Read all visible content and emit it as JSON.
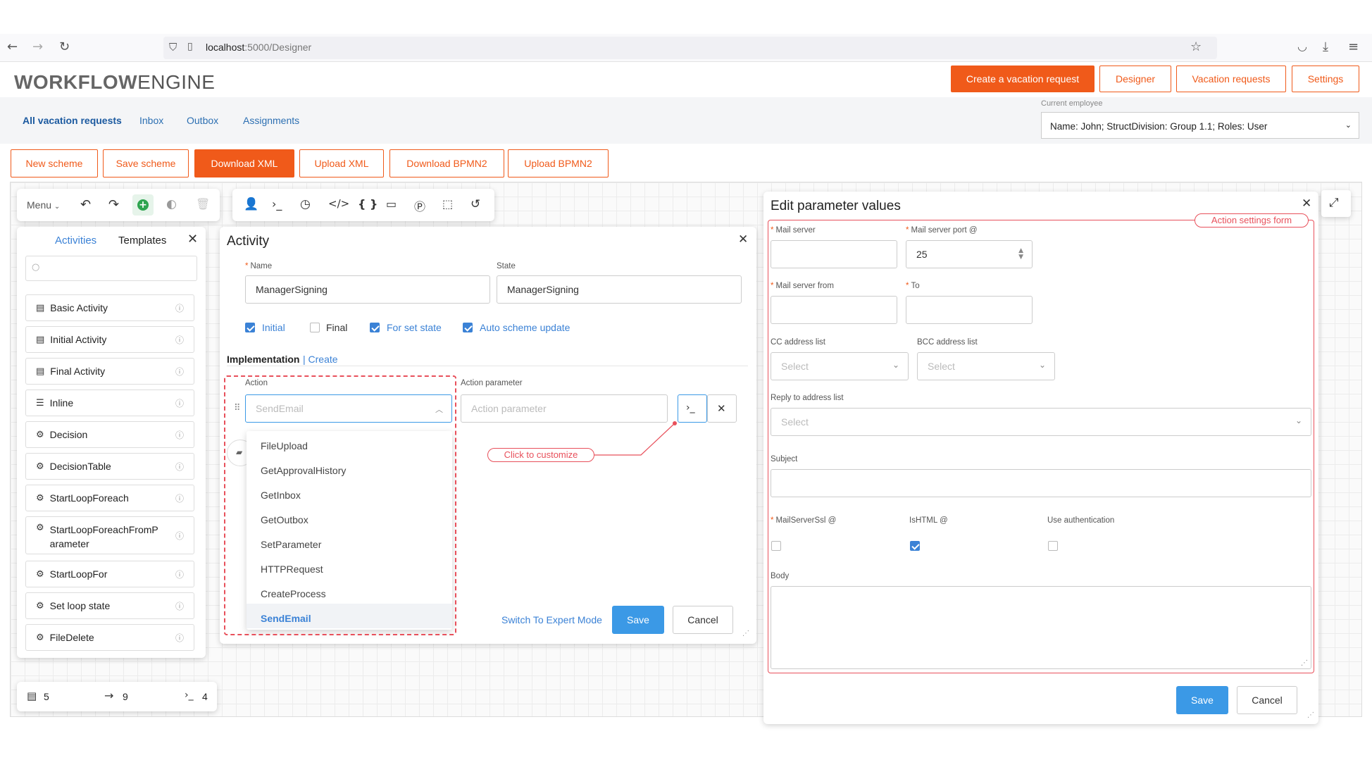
{
  "browser": {
    "url_host": "localhost",
    "url_path": ":5000/Designer"
  },
  "brand": {
    "bold": "WORKFLOW",
    "light": "ENGINE"
  },
  "header_buttons": [
    "Create a vacation request",
    "Designer",
    "Vacation requests",
    "Settings"
  ],
  "nav_tabs": [
    "All vacation requests",
    "Inbox",
    "Outbox",
    "Assignments"
  ],
  "employee": {
    "label": "Current employee",
    "value": "Name: John; StructDivision: Group 1.1; Roles: User"
  },
  "toolbar_buttons": [
    "New scheme",
    "Save scheme",
    "Download XML",
    "Upload XML",
    "Download BPMN2",
    "Upload BPMN2"
  ],
  "designer_menu": {
    "label": "Menu"
  },
  "side_panel": {
    "tab_activities": "Activities",
    "tab_templates": "Templates",
    "items": [
      "Basic Activity",
      "Initial Activity",
      "Final Activity",
      "Inline",
      "Decision",
      "DecisionTable",
      "StartLoopForeach",
      "StartLoopForeachFromParameter",
      "StartLoopFor",
      "Set loop state",
      "FileDelete"
    ]
  },
  "stats": {
    "activities": "5",
    "transitions": "9",
    "commands": "4"
  },
  "activity_form": {
    "title": "Activity",
    "name_label": "Name",
    "name_value": "ManagerSigning",
    "state_label": "State",
    "state_value": "ManagerSigning",
    "checkboxes": [
      {
        "label": "Initial",
        "checked": true
      },
      {
        "label": "Final",
        "checked": false
      },
      {
        "label": "For set state",
        "checked": true
      },
      {
        "label": "Auto scheme update",
        "checked": true
      }
    ],
    "impl_label": "Implementation",
    "impl_create": "Create",
    "action_label": "Action",
    "action_placeholder": "SendEmail",
    "action_param_label": "Action parameter",
    "action_param_placeholder": "Action parameter",
    "dropdown_options": [
      "FileUpload",
      "GetApprovalHistory",
      "GetInbox",
      "GetOutbox",
      "SetParameter",
      "HTTPRequest",
      "CreateProcess",
      "SendEmail"
    ],
    "selected_option": "SendEmail",
    "callout": "Click to customize",
    "expert_mode": "Switch To Expert Mode",
    "save": "Save",
    "cancel": "Cancel"
  },
  "param_form": {
    "title": "Edit parameter values",
    "callout": "Action settings form",
    "mail_server_label": "Mail server",
    "mail_port_label": "Mail server port @",
    "mail_port_value": "25",
    "mail_from_label": "Mail server from",
    "to_label": "To",
    "cc_label": "CC address list",
    "bcc_label": "BCC address list",
    "reply_label": "Reply to address list",
    "select_placeholder": "Select",
    "subject_label": "Subject",
    "ssl_label": "MailServerSsl @",
    "ishtml_label": "IsHTML @",
    "auth_label": "Use authentication",
    "body_label": "Body",
    "save": "Save",
    "cancel": "Cancel"
  },
  "colors": {
    "accent": "#f05a1a",
    "blue": "#3b99e6",
    "annotation": "#e8505b"
  }
}
